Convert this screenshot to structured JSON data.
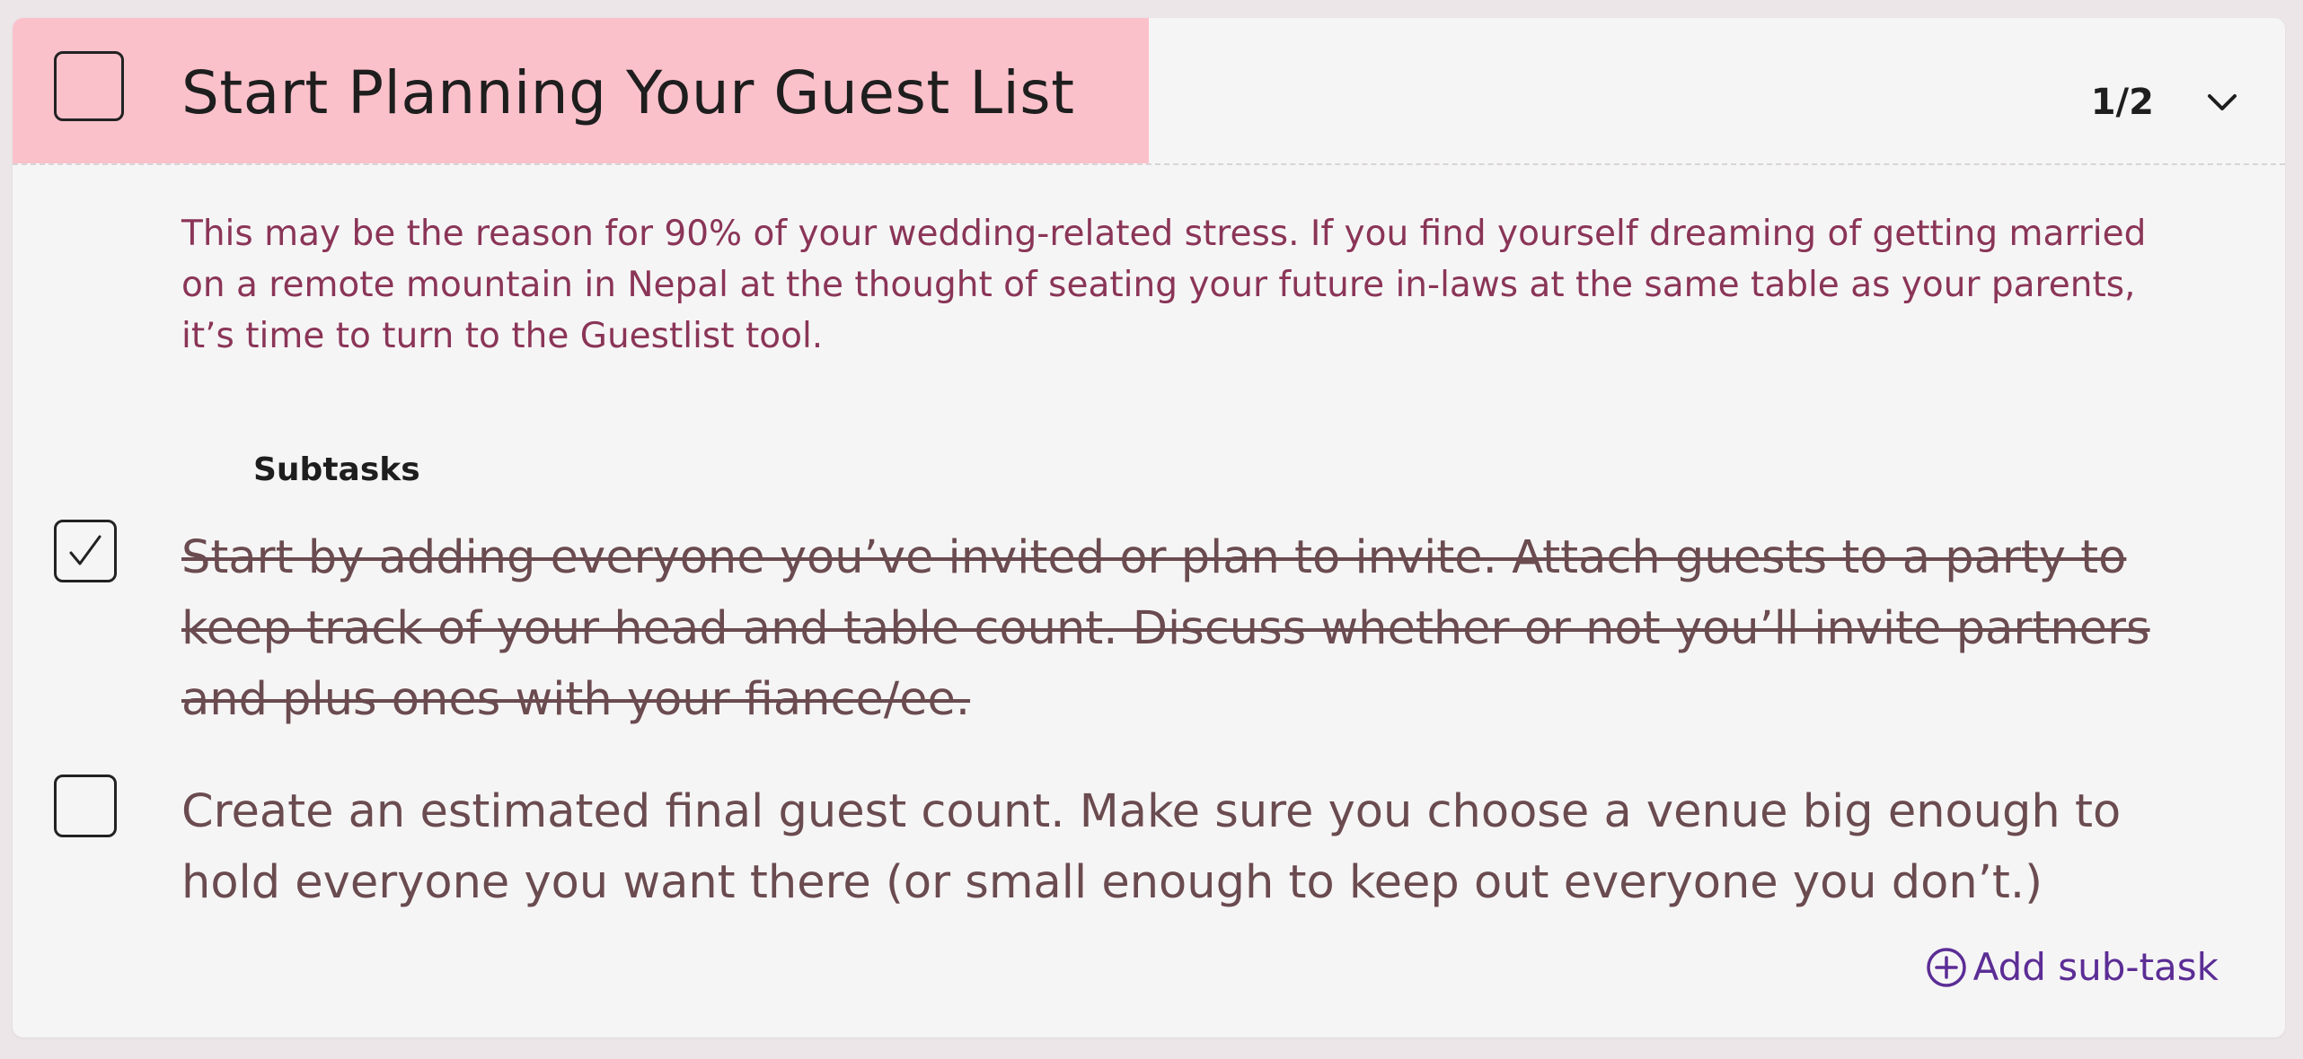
{
  "task": {
    "title": "Start Planning Your Guest List",
    "counter": "1/2",
    "description": "This may be the reason for 90% of your wedding-related stress. If you find yourself dreaming of getting married on a remote mountain in Nepal at the thought of seating your future in-laws at the same table as your parents, it’s time to turn to the Guestlist tool.",
    "completed": false,
    "progress_fraction": 0.5
  },
  "subtasks": {
    "heading": "Subtasks",
    "items": [
      {
        "text": "Start by adding everyone you’ve invited or plan to invite. Attach guests to a party to keep track of your head and table count. Discuss whether or not you’ll invite partners and plus ones with your fiance/ee.",
        "checked": true
      },
      {
        "text": "Create an estimated final guest count. Make sure you choose a venue big enough to hold everyone you want there (or small enough to keep out everyone you don’t.)",
        "checked": false
      }
    ],
    "add_label": "Add sub-task"
  },
  "icons": {
    "expand": "chevron-down-icon",
    "add": "plus-circle-icon",
    "check": "checkmark-icon"
  },
  "colors": {
    "progress_fill": "#fbc1cb",
    "description_text": "#8a3557",
    "subtask_text": "#6a4b4f",
    "accent": "#5b2d95"
  }
}
